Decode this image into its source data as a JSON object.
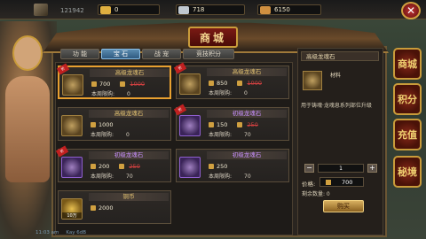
{
  "header": {
    "power": "121942",
    "resources": [
      {
        "name": "gold",
        "value": "0",
        "color": "#e0b040"
      },
      {
        "name": "silver",
        "value": "718",
        "color": "#c0c8d0"
      },
      {
        "name": "bound-gold",
        "value": "6150",
        "color": "#d09040"
      }
    ]
  },
  "shop": {
    "title": "商城",
    "tabs": [
      "功 能",
      "宝 石",
      "战 宠",
      "竞技积分"
    ],
    "active_tab": 1
  },
  "items": [
    {
      "name": "高级龙魂石",
      "price": "700",
      "old_price": "1000",
      "limit_label": "本周限购:",
      "limit": "0",
      "selected": true,
      "rarity": "gold",
      "badge": true
    },
    {
      "name": "高级龙魂石",
      "price": "850",
      "old_price": "1000",
      "limit_label": "本周限购:",
      "limit": "0",
      "selected": false,
      "rarity": "gold",
      "badge": true
    },
    {
      "name": "高级龙魂石",
      "price": "1000",
      "old_price": "",
      "limit_label": "本周限购:",
      "limit": "0",
      "selected": false,
      "rarity": "gold",
      "badge": false
    },
    {
      "name": "初级龙魂石",
      "price": "150",
      "old_price": "250",
      "limit_label": "本周限购:",
      "limit": "70",
      "selected": false,
      "rarity": "purple",
      "badge": true
    },
    {
      "name": "初级龙魂石",
      "price": "200",
      "old_price": "250",
      "limit_label": "本周限购:",
      "limit": "70",
      "selected": false,
      "rarity": "purple",
      "badge": true
    },
    {
      "name": "初级龙魂石",
      "price": "250",
      "old_price": "",
      "limit_label": "本周限购:",
      "limit": "70",
      "selected": false,
      "rarity": "purple",
      "badge": false
    },
    {
      "name": "铜币",
      "price": "2000",
      "old_price": "",
      "limit_label": "",
      "limit": "",
      "selected": false,
      "rarity": "coin",
      "badge": false,
      "qty": "10万"
    }
  ],
  "detail": {
    "title": "高级龙魂石",
    "type": "材料",
    "description": "用于铸魂·龙魂息系列部位升级",
    "quantity": "1",
    "price_label": "价格:",
    "price": "700",
    "remain_label": "剩余数量: 0",
    "buy_label": "购买"
  },
  "side_tabs": [
    "商城",
    "积分",
    "充值",
    "秘境"
  ],
  "status": {
    "time": "11:03 am",
    "net": "Kay 6dB"
  }
}
